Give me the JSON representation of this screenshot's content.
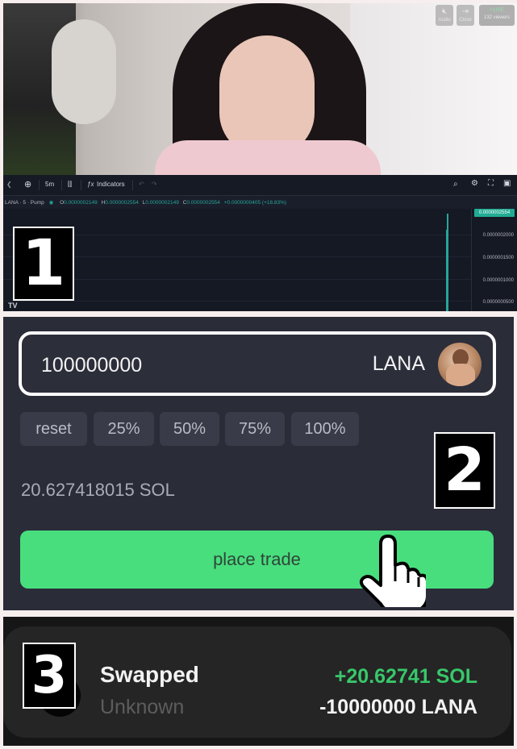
{
  "stream": {
    "audio_label": "Audio",
    "close_label": "Close",
    "live_label": "• LIVE",
    "viewers": "132 viewers"
  },
  "chart": {
    "toolbar": {
      "interval": "5m",
      "indicators_label": "Indicators",
      "fx_glyph": "ƒx"
    },
    "symbol": "LANA · 5 · Pump",
    "ohlc": {
      "o_label": "O",
      "o": "0.0000002149",
      "h_label": "H",
      "h": "0.0000002554",
      "l_label": "L",
      "l": "0.0000002149",
      "c_label": "C",
      "c": "0.0000002554",
      "change": "+0.0000000405 (+18.83%)"
    },
    "price_tag": "0.0000002554",
    "price_ticks": [
      "0.0000002000",
      "0.0000001500",
      "0.0000001000",
      "0.0000000500"
    ],
    "watermark": "TV",
    "colors": {
      "up": "#26a69a",
      "tag": "#22ab94",
      "bg": "#151924"
    }
  },
  "labels": {
    "one": "1",
    "two": "2",
    "three": "3"
  },
  "trade": {
    "amount": "100000000",
    "token": "LANA",
    "buttons": [
      "reset",
      "25%",
      "50%",
      "75%",
      "100%"
    ],
    "sol_balance": "20.627418015 SOL",
    "place_trade": "place trade",
    "colors": {
      "accent": "#48de7e",
      "panel": "#2a2c38"
    }
  },
  "swap": {
    "title": "Swapped",
    "subtitle": "Unknown",
    "sol_change": "+20.62741 SOL",
    "token_change": "-10000000 LANA",
    "colors": {
      "positive": "#38c76a"
    }
  }
}
